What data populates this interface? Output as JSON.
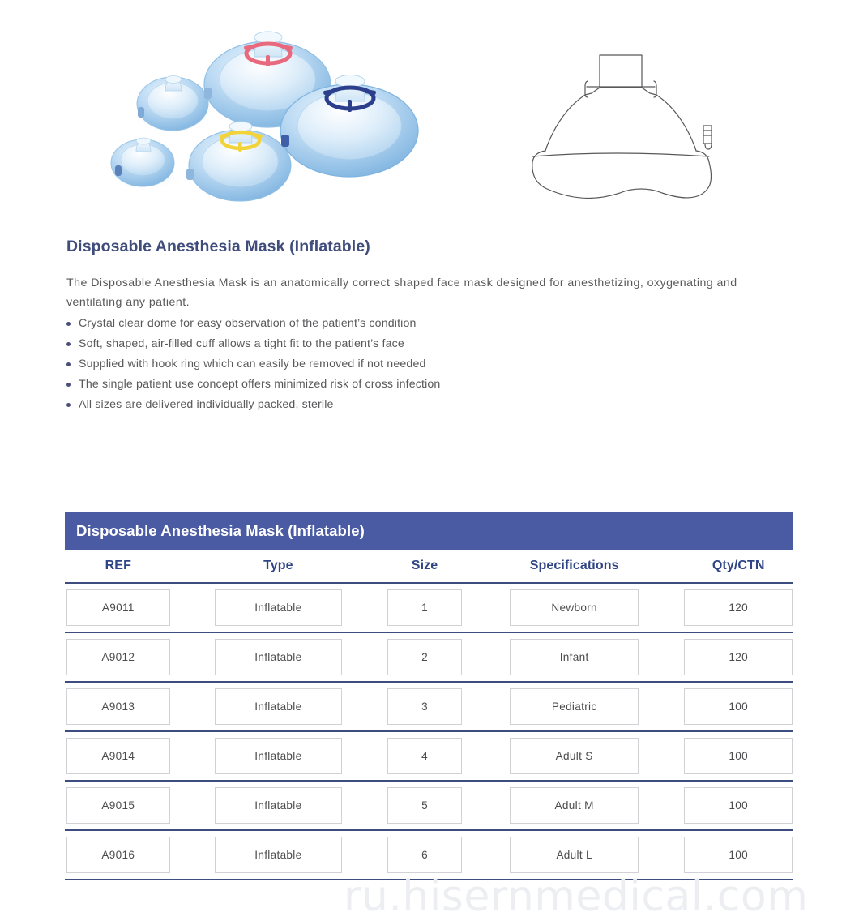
{
  "hero": {
    "photo_alt": "five-inflatable-anesthesia-masks-photo",
    "drawing_alt": "anesthesia-mask-side-profile-line-drawing",
    "mask_ring_colors": [
      "#e8697d",
      "#f2d33a",
      "#2b3f8c"
    ],
    "mask_body_color": "#bcd8f0"
  },
  "product": {
    "title": "Disposable Anesthesia Mask (Inflatable)",
    "intro": "The Disposable Anesthesia Mask is an anatomically correct shaped face mask designed for anesthetizing, oxygenating and ventilating any patient.",
    "features": [
      "Crystal clear dome for easy observation of the patient’s condition",
      "Soft, shaped, air-filled cuff allows a tight fit to the patient’s face",
      "Supplied with hook ring which can easily be removed if not needed",
      "The single patient use concept offers minimized risk of cross infection",
      "All sizes are delivered individually packed, sterile"
    ]
  },
  "table": {
    "banner": "Disposable Anesthesia Mask (Inflatable)",
    "columns": [
      "REF",
      "Type",
      "Size",
      "Specifications",
      "Qty/CTN"
    ],
    "rows": [
      {
        "ref": "A9011",
        "type": "Inflatable",
        "size": "1",
        "spec": "Newborn",
        "qty": "120"
      },
      {
        "ref": "A9012",
        "type": "Inflatable",
        "size": "2",
        "spec": "Infant",
        "qty": "120"
      },
      {
        "ref": "A9013",
        "type": "Inflatable",
        "size": "3",
        "spec": "Pediatric",
        "qty": "100"
      },
      {
        "ref": "A9014",
        "type": "Inflatable",
        "size": "4",
        "spec": "Adult S",
        "qty": "100"
      },
      {
        "ref": "A9015",
        "type": "Inflatable",
        "size": "5",
        "spec": "Adult M",
        "qty": "100"
      },
      {
        "ref": "A9016",
        "type": "Inflatable",
        "size": "6",
        "spec": "Adult L",
        "qty": "100"
      }
    ]
  },
  "watermark": {
    "text": "ru.hisernmedical.com"
  },
  "colors": {
    "banner_blue": "#4a5ba3",
    "heading_blue": "#3f4c7c",
    "column_head_blue": "#2f4484",
    "rule_blue": "#3d4d80",
    "body_text": "#59595b",
    "cell_border": "#d0d2d6",
    "watermark_gray": "#eceef2"
  }
}
